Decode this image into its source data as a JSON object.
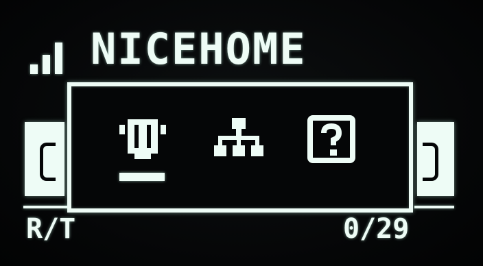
{
  "header": {
    "ssid": "NICEHOME",
    "signal_icon": "signal-strength-icon"
  },
  "menu": {
    "items": [
      {
        "icon": "bluetooth-device-icon",
        "selected": true
      },
      {
        "icon": "network-tree-icon",
        "selected": false
      },
      {
        "icon": "help-question-icon",
        "selected": false
      }
    ]
  },
  "footer": {
    "left": "R/T",
    "right": "0/29"
  },
  "colors": {
    "foreground": "#eefcf6",
    "background": "#050607"
  }
}
